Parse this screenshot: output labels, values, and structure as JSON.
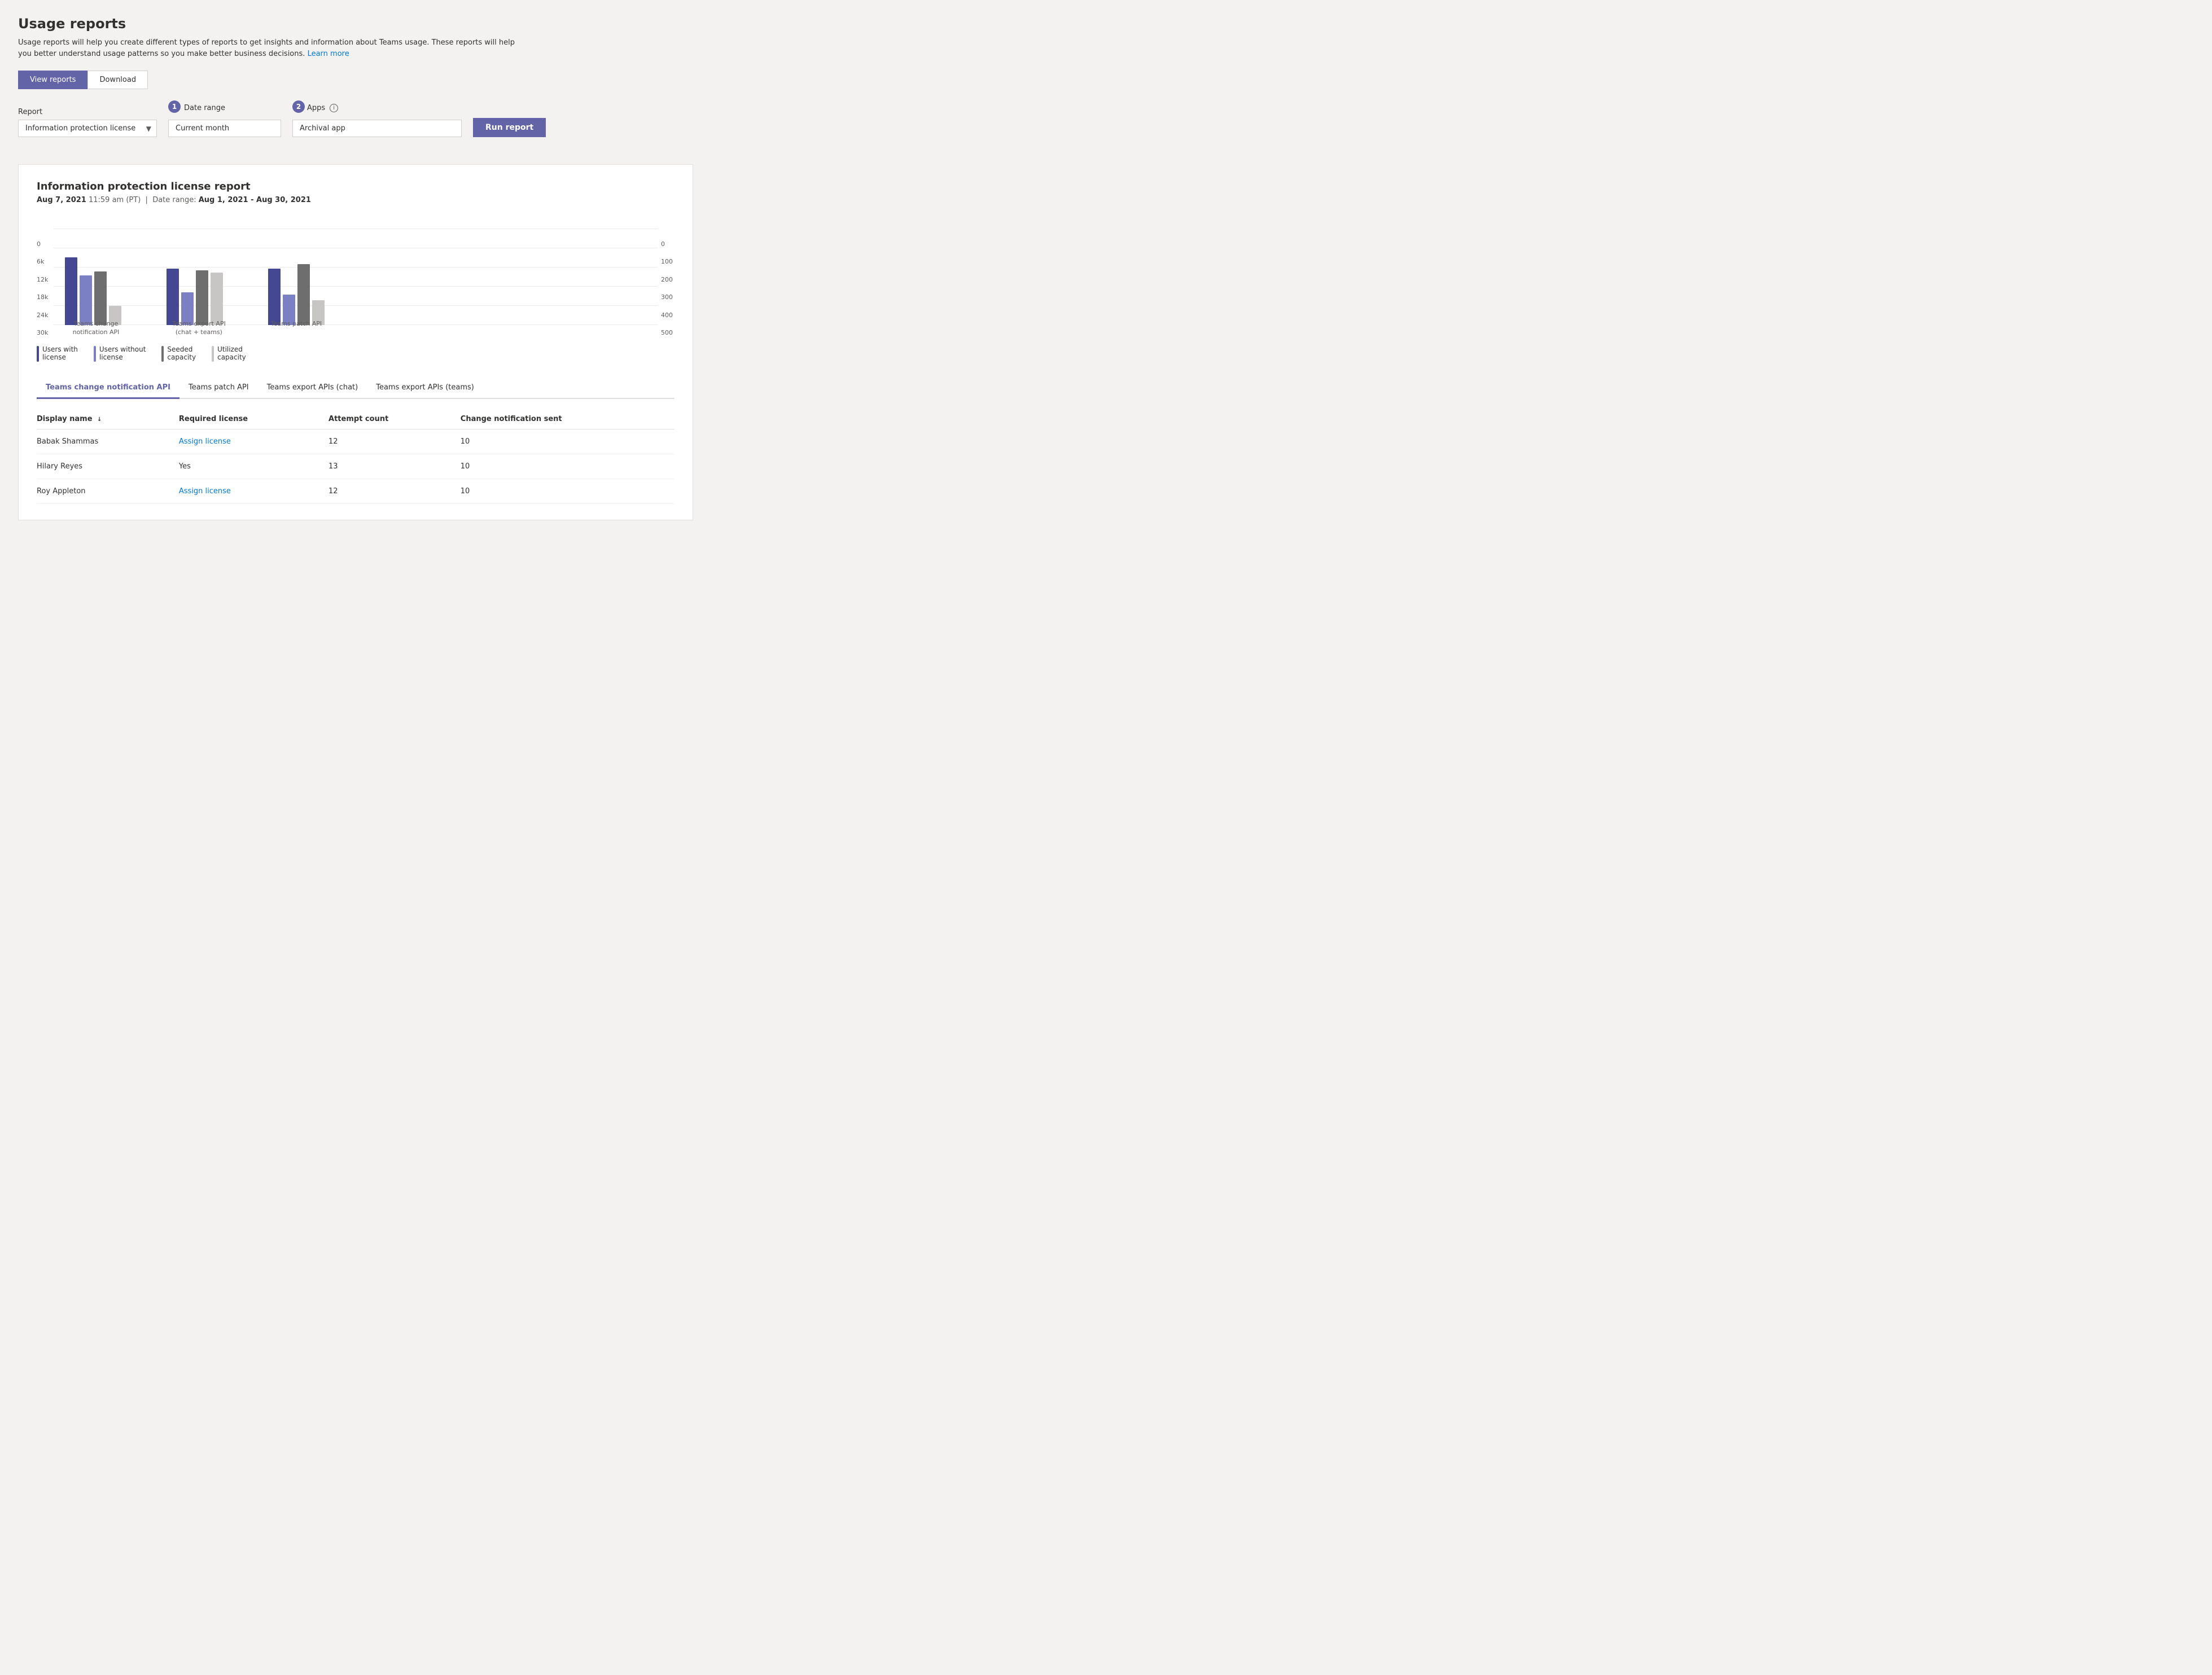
{
  "page": {
    "title": "Usage reports",
    "subtitle": "Usage reports will help you create different types of reports to get insights and information about Teams usage. These reports will help you better understand usage patterns so you make better business decisions.",
    "learn_more_text": "Learn more",
    "learn_more_url": "#"
  },
  "main_tabs": [
    {
      "id": "view-reports",
      "label": "View reports",
      "active": true
    },
    {
      "id": "download",
      "label": "Download",
      "active": false
    }
  ],
  "controls": {
    "step1_badge": "1",
    "step2_badge": "2",
    "report_label": "Report",
    "report_value": "Information protection license",
    "date_range_label": "Date range",
    "date_range_value": "Current month",
    "apps_label": "Apps",
    "apps_info": "i",
    "apps_value": "Archival app",
    "run_button_label": "Run report"
  },
  "report": {
    "title": "Information protection license report",
    "date_generated": "Aug 7, 2021",
    "time_generated": "11:59 am (PT)",
    "date_range_label": "Date range:",
    "date_range_value": "Aug 1, 2021 - Aug 30, 2021",
    "chart": {
      "y_axis_left": [
        "0",
        "6k",
        "12k",
        "18k",
        "24k",
        "30k"
      ],
      "y_axis_right": [
        "0",
        "100",
        "200",
        "300",
        "400",
        "500"
      ],
      "groups": [
        {
          "label": "Teams change notification API",
          "bars": [
            {
              "type": "blue-dark",
              "height": 120
            },
            {
              "type": "purple",
              "height": 90
            },
            {
              "type": "gray",
              "height": 95
            },
            {
              "type": "light-gray",
              "height": 35
            }
          ]
        },
        {
          "label": "Teams export API\n(chat + teams)",
          "bars": [
            {
              "type": "blue-dark",
              "height": 100
            },
            {
              "type": "purple",
              "height": 60
            },
            {
              "type": "gray",
              "height": 98
            },
            {
              "type": "light-gray",
              "height": 95
            }
          ]
        },
        {
          "label": "Teams patch API",
          "bars": [
            {
              "type": "blue-dark",
              "height": 100
            },
            {
              "type": "purple",
              "height": 55
            },
            {
              "type": "gray",
              "height": 108
            },
            {
              "type": "light-gray",
              "height": 45
            }
          ]
        }
      ],
      "legend": [
        {
          "color": "blue-dark",
          "label": "Users with\nlicense"
        },
        {
          "color": "purple",
          "label": "Users without\nlicense"
        },
        {
          "color": "gray",
          "label": "Seeded\ncapacity"
        },
        {
          "color": "light-gray",
          "label": "Utilized\ncapacity"
        }
      ]
    },
    "data_tabs": [
      {
        "id": "teams-change-notification",
        "label": "Teams change notification API",
        "active": true
      },
      {
        "id": "teams-patch",
        "label": "Teams patch API",
        "active": false
      },
      {
        "id": "teams-export-chat",
        "label": "Teams export APIs (chat)",
        "active": false
      },
      {
        "id": "teams-export-teams",
        "label": "Teams export APIs (teams)",
        "active": false
      }
    ],
    "table": {
      "columns": [
        {
          "id": "display-name",
          "label": "Display name",
          "sort": "asc"
        },
        {
          "id": "required-license",
          "label": "Required license"
        },
        {
          "id": "attempt-count",
          "label": "Attempt count"
        },
        {
          "id": "change-notification-sent",
          "label": "Change notification sent"
        }
      ],
      "rows": [
        {
          "display_name": "Babak Shammas",
          "required_license": "Assign license",
          "required_license_is_link": true,
          "attempt_count": "12",
          "change_notification_sent": "10"
        },
        {
          "display_name": "Hilary Reyes",
          "required_license": "Yes",
          "required_license_is_link": false,
          "attempt_count": "13",
          "change_notification_sent": "10"
        },
        {
          "display_name": "Roy Appleton",
          "required_license": "Assign license",
          "required_license_is_link": true,
          "attempt_count": "12",
          "change_notification_sent": "10"
        }
      ]
    }
  }
}
